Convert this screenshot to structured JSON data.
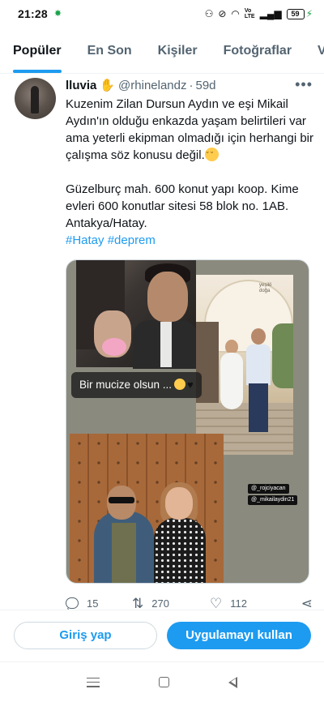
{
  "status_bar": {
    "time": "21:28",
    "battery": "59",
    "volte_top": "Vo",
    "volte_bottom": "LTE"
  },
  "tabs": [
    {
      "label": "Popüler",
      "active": true
    },
    {
      "label": "En Son",
      "active": false
    },
    {
      "label": "Kişiler",
      "active": false
    },
    {
      "label": "Fotoğraflar",
      "active": false
    },
    {
      "label": "Vi",
      "active": false
    }
  ],
  "tweet": {
    "name": "lluvia",
    "name_emoji": "hand-emoji",
    "handle": "@rhinelandz",
    "separator": "·",
    "time": "59d",
    "paragraph1": "Kuzenim Zilan Dursun Aydın ve eşi Mikail Aydın'ın olduğu enkazda yaşam belirtileri var ama yeterli ekipman olmadığı için herhangi bir çalışma söz konusu değil.",
    "paragraph2": "Güzelburç mah. 600 konut yapı koop. Kime evleri 600 konutlar sitesi 58 blok no. 1AB. Antakya/Hatay.",
    "hashtags": "#Hatay #deprem",
    "media": {
      "caption": "Bir mucize olsun ...",
      "tag1": "@_rojciyacan",
      "tag2": "@_mikailaydin21",
      "watermark_line1": "yeşilö",
      "watermark_line2": "doğa"
    },
    "actions": {
      "replies": "15",
      "retweets": "270",
      "likes": "112"
    }
  },
  "login_bar": {
    "login_label": "Giriş yap",
    "app_label": "Uygulamayı kullan"
  },
  "colors": {
    "accent": "#1d9bf0",
    "text": "#0f1419",
    "muted": "#536471"
  }
}
